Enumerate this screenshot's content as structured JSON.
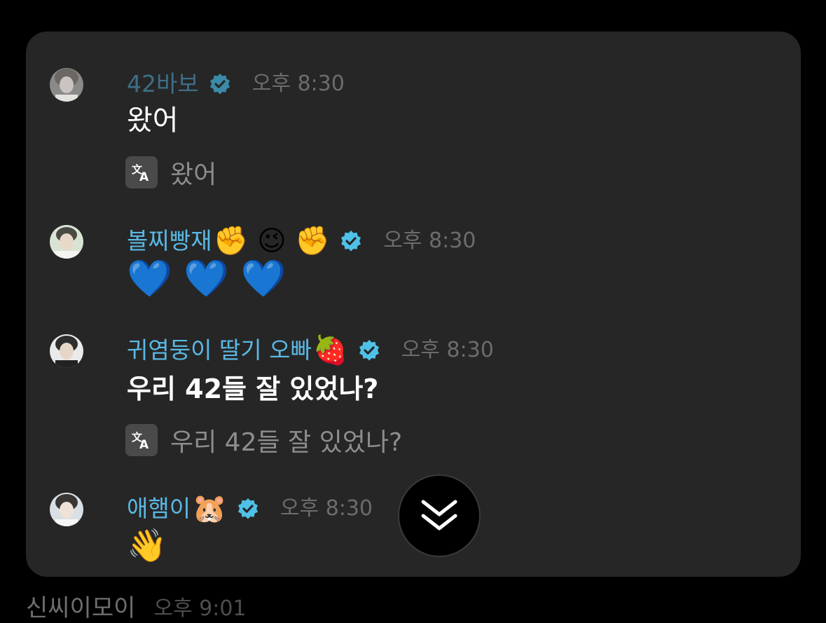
{
  "colors": {
    "card_bg": "#262626",
    "name_dark_blue": "#3d6e88",
    "name_light_blue": "#5ab8e4",
    "time_gray": "#6c6c6c",
    "verified_dark": "#3b8aa8",
    "verified_light": "#4fc1e8"
  },
  "messages": [
    {
      "name": "42바보",
      "emojis": "",
      "time": "오후 8:30",
      "text": "왔어",
      "translation": "왔어",
      "avatar_icon": "profile-photo-icon"
    },
    {
      "name": "볼찌빵재",
      "emojis": "✊ 😉 ✊",
      "time": "오후 8:30",
      "text": "💙 💙 💙",
      "avatar_icon": "profile-photo-icon"
    },
    {
      "name": "귀염둥이 딸기 오빠",
      "emojis": "🍓",
      "time": "오후 8:30",
      "text": "우리 42들 잘 있었나?",
      "translation": "우리 42들 잘 있었나?",
      "avatar_icon": "profile-photo-icon"
    },
    {
      "name": "애햄이",
      "emojis": "🐹",
      "time": "오후 8:30",
      "text": "👋",
      "avatar_icon": "profile-photo-icon"
    }
  ],
  "scroll_button": {
    "icon": "double-chevron-down-icon"
  },
  "next_message": {
    "name": "신씨이모이",
    "time": "오후 9:01"
  }
}
